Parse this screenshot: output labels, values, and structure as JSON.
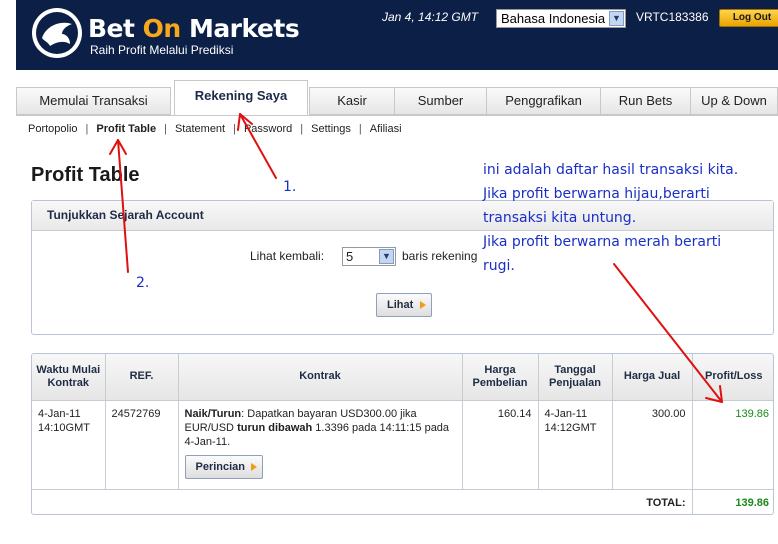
{
  "header": {
    "brand_main": "Bet ",
    "brand_accent": "On",
    "brand_rest": " Markets",
    "tagline": "Raih Profit Melalui Prediksi",
    "datetime": "Jan 4, 14:12 GMT",
    "language": "Bahasa Indonesia",
    "account_id": "VRTC183386",
    "logout_label": "Log Out",
    "colors": {
      "navy": "#0b1f47",
      "accent": "#f6a81c"
    }
  },
  "tabs": [
    {
      "label": "Memulai Transaksi"
    },
    {
      "label": "Rekening Saya",
      "active": true
    },
    {
      "label": "Kasir"
    },
    {
      "label": "Sumber"
    },
    {
      "label": "Penggrafikan"
    },
    {
      "label": "Run Bets"
    },
    {
      "label": "Up & Down"
    }
  ],
  "subnav": [
    {
      "label": "Portopolio"
    },
    {
      "label": "Profit Table",
      "active": true
    },
    {
      "label": "Statement"
    },
    {
      "label": "Password"
    },
    {
      "label": "Settings"
    },
    {
      "label": "Afiliasi"
    }
  ],
  "page_title": "Profit Table",
  "history_panel": {
    "title": "Tunjukkan Sejarah Account",
    "lookback_label": "Lihat kembali:",
    "lookback_value": "5",
    "lookback_suffix": "baris rekening",
    "submit_label": "Lihat"
  },
  "table": {
    "headers": {
      "start_time": "Waktu Mulai Kontrak",
      "ref": "REF.",
      "contract": "Kontrak",
      "buy_price": "Harga Pembelian",
      "sell_date": "Tanggal Penjualan",
      "sell_price": "Harga Jual",
      "profit_loss": "Profit/Loss"
    },
    "rows": [
      {
        "start_date": "4-Jan-11",
        "start_time": "14:10GMT",
        "ref": "24572769",
        "contract_type": "Naik/Turun",
        "contract_text_1": ": Dapatkan bayaran USD300.00 jika EUR/USD ",
        "contract_bold": "turun dibawah",
        "contract_text_2": " 1.3396 pada 14:11:15 pada 4-Jan-11.",
        "details_label": "Perincian",
        "buy_price": "160.14",
        "sell_date": "4-Jan-11",
        "sell_time": "14:12GMT",
        "sell_price": "300.00",
        "profit_loss": "139.86"
      }
    ],
    "total_label": "TOTAL:",
    "total_value": "139.86",
    "profit_color": "#1a8a1a"
  },
  "annotations": {
    "label_1": "1.",
    "label_2": "2.",
    "note_line_1": "ini adalah daftar hasil transaksi kita.",
    "note_line_2": "Jika profit berwarna hijau,berarti",
    "note_line_3": "transaksi kita untung.",
    "note_line_4": "Jika profit berwarna merah berarti",
    "note_line_5": "rugi.",
    "arrow_color": "#e01010"
  }
}
